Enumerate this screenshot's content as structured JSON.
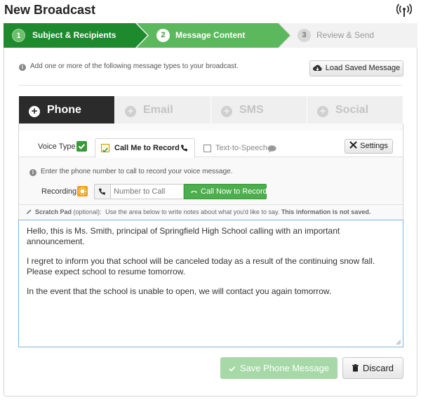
{
  "page": {
    "title": "New Broadcast",
    "signal_icon": "signal-icon"
  },
  "steps": [
    {
      "num": "1",
      "label": "Subject & Recipients",
      "state": "done"
    },
    {
      "num": "2",
      "label": "Message Content",
      "state": "active"
    },
    {
      "num": "3",
      "label": "Review & Send",
      "state": "todo"
    }
  ],
  "intro": {
    "text": "Add one or more of the following message types to your broadcast.",
    "load_button": "Load Saved Message"
  },
  "tabs": [
    {
      "label": "Phone",
      "active": true
    },
    {
      "label": "Email",
      "active": false
    },
    {
      "label": "SMS",
      "active": false
    },
    {
      "label": "Social",
      "active": false
    }
  ],
  "voice": {
    "voice_type_label": "Voice Type",
    "call_me_label": "Call Me to Record",
    "tts_label": "Text-to-Speech",
    "settings_label": "Settings",
    "hint": "Enter the phone number to call to record your voice message.",
    "recording_label": "Recording",
    "phone_placeholder": "Number to Call",
    "call_now_label": "Call Now to Record"
  },
  "scratch": {
    "label": "Scratch Pad",
    "optional": "(optional):",
    "desc": "Use the area below to write notes about what you'd like to say.",
    "warning": "This information is not saved."
  },
  "message": {
    "p1": "Hello, this is Ms. Smith, principal of Springfield High School calling with an important announcement.",
    "p2": "I regret to inform you that school will be canceled today as a result of the continuing snow fall. Please expect school to resume tomorrow.",
    "p3": "In the event that the school is unable to open, we will contact you again tomorrow."
  },
  "actions": {
    "save_label": "Save Phone Message",
    "discard_label": "Discard"
  },
  "colors": {
    "step_done": "#1e8a2e",
    "step_active": "#5cb85c",
    "phone_tab": "#2b2b2b",
    "call_now": "#4cae4c",
    "save_disabled": "#a7d8a7"
  }
}
